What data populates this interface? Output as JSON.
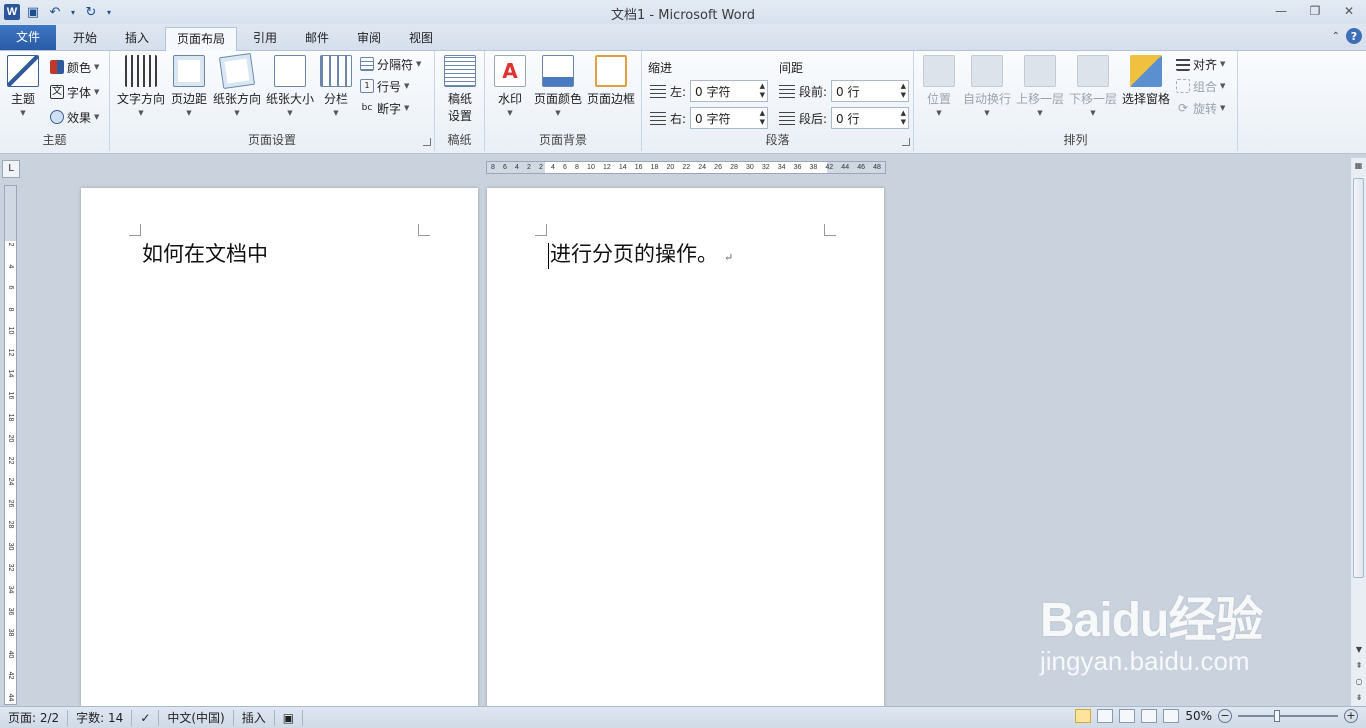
{
  "titlebar": {
    "app_logo": "W",
    "title": "文档1 - Microsoft Word"
  },
  "tabs": [
    {
      "label": "文件"
    },
    {
      "label": "开始"
    },
    {
      "label": "插入"
    },
    {
      "label": "页面布局"
    },
    {
      "label": "引用"
    },
    {
      "label": "邮件"
    },
    {
      "label": "审阅"
    },
    {
      "label": "视图"
    }
  ],
  "active_tab": "页面布局",
  "ribbon": {
    "theme_group": {
      "label": "主题",
      "theme_button": "主题",
      "colors": "颜色",
      "fonts": "字体",
      "effects": "效果"
    },
    "page_setup_group": {
      "label": "页面设置",
      "text_direction": "文字方向",
      "margins": "页边距",
      "orientation": "纸张方向",
      "size": "纸张大小",
      "columns": "分栏",
      "breaks": "分隔符",
      "line_numbers": "行号",
      "hyphenation": "断字"
    },
    "manuscript_group": {
      "label": "稿纸",
      "manuscript_settings": "稿纸\n设置"
    },
    "page_background_group": {
      "label": "页面背景",
      "watermark": "水印",
      "page_color": "页面颜色",
      "page_borders": "页面边框"
    },
    "paragraph_group": {
      "label": "段落",
      "indent_title": "缩进",
      "indent_left_label": "左:",
      "indent_left_value": "0 字符",
      "indent_right_label": "右:",
      "indent_right_value": "0 字符",
      "spacing_title": "间距",
      "spacing_before_label": "段前:",
      "spacing_before_value": "0 行",
      "spacing_after_label": "段后:",
      "spacing_after_value": "0 行"
    },
    "arrange_group": {
      "label": "排列",
      "position": "位置",
      "wrap_text": "自动换行",
      "bring_forward": "上移一层",
      "send_backward": "下移一层",
      "selection_pane": "选择窗格",
      "align": "对齐",
      "group": "组合",
      "rotate": "旋转"
    }
  },
  "ruler": {
    "horizontal_ticks": [
      "8",
      "6",
      "4",
      "2",
      "2",
      "4",
      "6",
      "8",
      "10",
      "12",
      "14",
      "16",
      "18",
      "20",
      "22",
      "24",
      "26",
      "28",
      "30",
      "32",
      "34",
      "36",
      "38",
      "42",
      "44",
      "46",
      "48"
    ],
    "vertical_ticks": [
      "2",
      "4",
      "6",
      "8",
      "10",
      "12",
      "14",
      "16",
      "18",
      "20",
      "22",
      "24",
      "26",
      "28",
      "30",
      "32",
      "34",
      "36",
      "38",
      "40",
      "42",
      "44"
    ]
  },
  "document": {
    "page1_text": "如何在文档中",
    "page2_text": "进行分页的操作。"
  },
  "statusbar": {
    "page": "页面: 2/2",
    "words": "字数: 14",
    "language": "中文(中国)",
    "mode": "插入",
    "zoom": "50%"
  },
  "watermark": {
    "logo": "Baidu经验",
    "url": "jingyan.baidu.com"
  }
}
